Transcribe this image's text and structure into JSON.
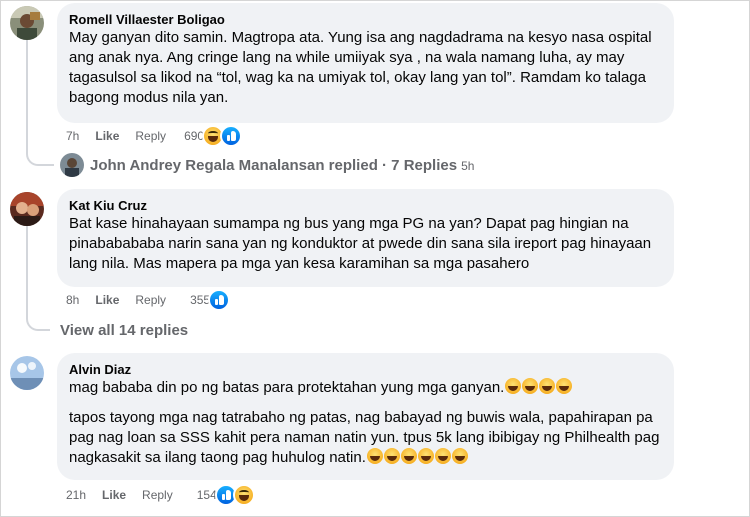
{
  "comments": [
    {
      "author": "Romell Villaester Boligao",
      "text": [
        "May ganyan dito samin. Magtropa ata. Yung isa ang nagdadrama na kesyo nasa ospital ang anak nya. Ang cringe lang na while umiiyak sya , na wala namang luha, ay may tagasulsol sa likod na “tol, wag ka na umiyak tol, okay lang yan tol”. Ramdam ko talaga bagong modus nila yan."
      ],
      "time": "7h",
      "like_label": "Like",
      "reply_label": "Reply",
      "reaction_count": "690",
      "reactions": [
        "haha-icon",
        "like-icon"
      ]
    },
    {
      "author": "Kat Kiu Cruz",
      "text": [
        "Bat kase hinahayaan sumampa ng bus yang mga PG na yan? Dapat pag hingian na pinababababa narin sana yan ng konduktor at pwede din sana sila ireport pag hinayaan lang nila. Mas mapera pa mga yan kesa karamihan sa mga pasahero"
      ],
      "time": "8h",
      "like_label": "Like",
      "reply_label": "Reply",
      "reaction_count": "355",
      "reactions": [
        "like-icon"
      ]
    },
    {
      "author": "Alvin Diaz",
      "text": [
        "mag bababa din po ng batas para protektahan yung mga ganyan.",
        "tapos tayong mga nag tatrabaho ng patas, nag babayad ng buwis wala, papahirapan pa pag nag loan sa SSS kahit pera naman natin yun. tpus 5k lang ibibigay ng Philhealth pag nagkasakit sa ilang taong pag huhulog natin."
      ],
      "emoji_counts": [
        4,
        6
      ],
      "time": "21h",
      "like_label": "Like",
      "reply_label": "Reply",
      "reaction_count": "154",
      "reactions": [
        "like-icon",
        "haha-icon"
      ]
    }
  ],
  "reply_summary": {
    "text": "John Andrey Regala Manalansan replied · 7 Replies",
    "age": "5h"
  },
  "view_all": "View all 14 replies",
  "colors": {
    "bubble": "#f0f2f5",
    "meta": "#65676b",
    "like_blue": "#0866ff",
    "haha_yellow": "#f7b125"
  }
}
